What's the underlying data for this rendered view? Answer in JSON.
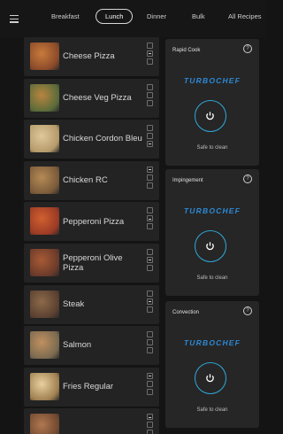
{
  "nav": {
    "menu_icon": "hamburger-icon",
    "tabs": [
      {
        "label": "Breakfast",
        "active": false
      },
      {
        "label": "Lunch",
        "active": true
      },
      {
        "label": "Dinner",
        "active": false
      },
      {
        "label": "Bulk",
        "active": false
      },
      {
        "label": "All Recipes",
        "active": false
      }
    ]
  },
  "recipes": [
    {
      "name": "Cheese Pizza",
      "checks": [
        false,
        true,
        false
      ]
    },
    {
      "name": "Cheese Veg Pizza",
      "checks": [
        false,
        false,
        false
      ]
    },
    {
      "name": "Chicken Cordon Bleu",
      "checks": [
        false,
        false,
        true
      ]
    },
    {
      "name": "Chicken RC",
      "checks": [
        true,
        false,
        false
      ]
    },
    {
      "name": "Pepperoni Pizza",
      "checks": [
        false,
        true,
        false
      ]
    },
    {
      "name": "Pepperoni Olive Pizza",
      "checks": [
        false,
        true,
        false
      ]
    },
    {
      "name": "Steak",
      "checks": [
        false,
        true,
        false
      ]
    },
    {
      "name": "Salmon",
      "checks": [
        false,
        false,
        false
      ]
    },
    {
      "name": "Fries Regular",
      "checks": [
        true,
        false,
        false
      ]
    },
    {
      "name": "",
      "checks": [
        true,
        false,
        false
      ]
    }
  ],
  "ovens": [
    {
      "title": "Rapid Cook",
      "brand": "TURBOCHEF",
      "status": "Safe to clean"
    },
    {
      "title": "Impingement",
      "brand": "TURBOCHEF",
      "status": "Safe to clean"
    },
    {
      "title": "Convection",
      "brand": "TURBOCHEF",
      "status": "Safe to clean"
    }
  ],
  "colors": {
    "background": "#141414",
    "card": "#232323",
    "panel": "#262626",
    "brand_blue": "#2d89d6",
    "power_ring": "#2fa7d9"
  }
}
